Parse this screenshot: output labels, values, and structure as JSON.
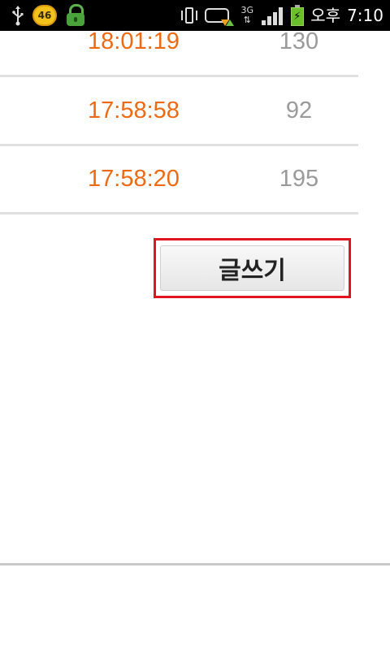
{
  "status_bar": {
    "notification_badge": "46",
    "network_type": "3G",
    "clock_period": "오후",
    "clock_time": "7:10",
    "icons": [
      "usb-icon",
      "app-badge-icon",
      "lock-icon",
      "vibrate-icon",
      "gamepad-icon",
      "3g-icon",
      "signal-icon",
      "battery-charging-icon"
    ]
  },
  "list": {
    "rows": [
      {
        "time": "18:01:19",
        "count": "130"
      },
      {
        "time": "17:58:58",
        "count": "92"
      },
      {
        "time": "17:58:20",
        "count": "195"
      }
    ]
  },
  "write_button": {
    "label": "글쓰기",
    "highlight_color": "#e0151f"
  },
  "colors": {
    "time_text": "#ec6a14",
    "count_text": "#9a9a9a",
    "divider": "#e0e0e0"
  }
}
